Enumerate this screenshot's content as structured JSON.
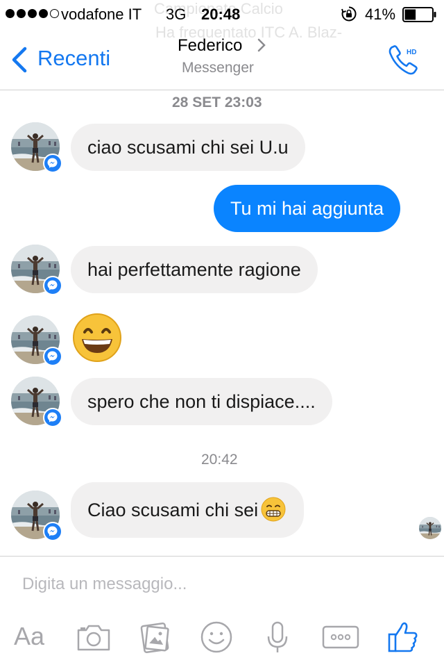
{
  "status_bar": {
    "carrier": "vodafone IT",
    "network": "3G",
    "time": "20:48",
    "battery": "41%",
    "battery_level": 0.41
  },
  "background_overlay": {
    "line1": "Campionato Calcio",
    "line2": "Ha frequentato ITC A. Blaz-"
  },
  "nav": {
    "back_label": "Recenti",
    "contact_name": "Federico",
    "subtitle": "Messenger",
    "call_badge": "HD"
  },
  "conversation": {
    "timestamp_1": "28 SET 23:03",
    "timestamp_2": "20:42",
    "messages": [
      {
        "from": "them",
        "text": "ciao scusami chi sei U.u"
      },
      {
        "from": "me",
        "text": "Tu mi hai aggiunta"
      },
      {
        "from": "them",
        "text": "hai perfettamente ragione"
      },
      {
        "from": "them",
        "emoji": "grinning-face"
      },
      {
        "from": "them",
        "text": "spero che non ti dispiace...."
      },
      {
        "from": "them",
        "text": "Ciao scusami chi sei",
        "emoji": "grimacing-face"
      }
    ]
  },
  "composer": {
    "placeholder": "Digita un messaggio...",
    "text_tool_label": "Aa",
    "tools": [
      "text-format-icon",
      "camera-icon",
      "gallery-icon",
      "sticker-icon",
      "microphone-icon",
      "more-icon",
      "like-icon"
    ]
  },
  "colors": {
    "accent": "#1478f0",
    "outgoing_bubble": "#0a84ff",
    "incoming_bubble": "#f1f0f0",
    "toolbar_icon": "#a7a7ab"
  }
}
